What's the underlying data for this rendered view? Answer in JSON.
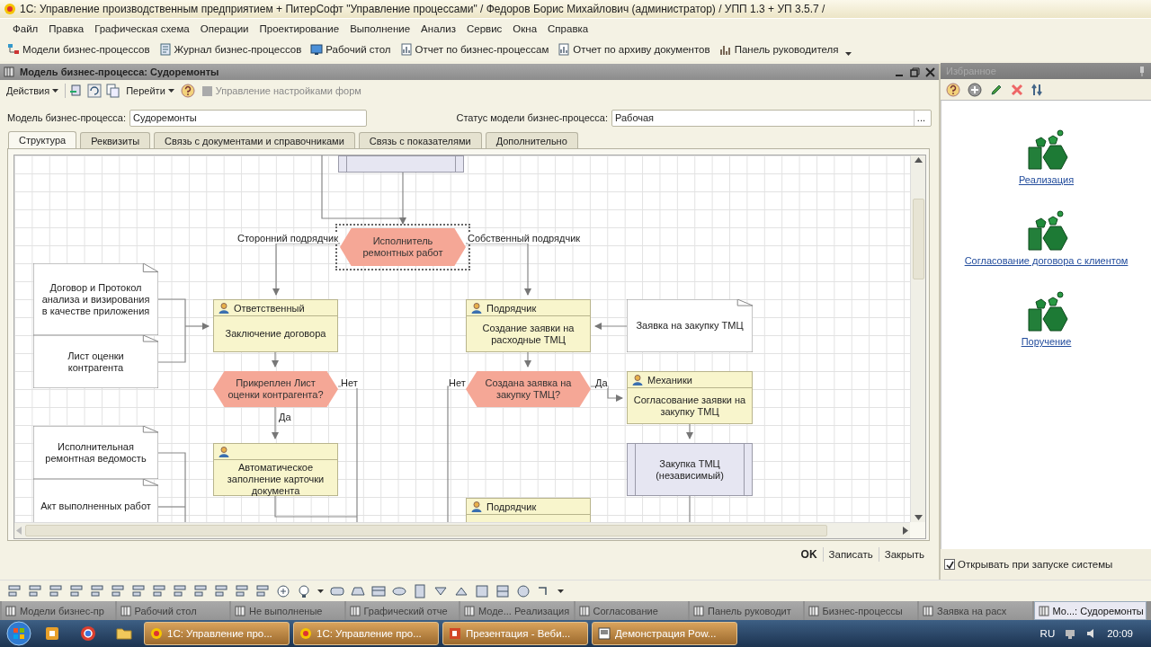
{
  "app_title": "1С: Управление производственным предприятием + ПитерСофт \"Управление процессами\" / Федоров Борис Михайлович (администратор) /  УПП 1.3 + УП 3.5.7 /",
  "menu": [
    "Файл",
    "Правка",
    "Графическая схема",
    "Операции",
    "Проектирование",
    "Выполнение",
    "Анализ",
    "Сервис",
    "Окна",
    "Справка"
  ],
  "toolbar": [
    {
      "label": "Модели бизнес-процессов"
    },
    {
      "label": "Журнал бизнес-процессов"
    },
    {
      "label": "Рабочий стол"
    },
    {
      "label": "Отчет по бизнес-процессам"
    },
    {
      "label": "Отчет по архиву документов"
    },
    {
      "label": "Панель руководителя"
    }
  ],
  "document_window": {
    "title": "Модель бизнес-процесса: Судоремонты",
    "toolbar": [
      {
        "kind": "menu",
        "label": "Действия",
        "disabled": false
      },
      {
        "kind": "menu",
        "label": "Перейти",
        "disabled": false
      },
      {
        "kind": "button",
        "label": "Управление настройками форм",
        "disabled": true
      }
    ],
    "fields": [
      {
        "label": "Модель бизнес-процесса:",
        "value": "Судоремонты"
      },
      {
        "label": "Статус модели бизнес-процесса:",
        "value": "Рабочая",
        "button": "..."
      }
    ],
    "tabs": [
      {
        "label": "Структура",
        "selected": true
      },
      {
        "label": "Реквизиты",
        "selected": false
      },
      {
        "label": "Связь с документами и справочниками",
        "selected": false
      },
      {
        "label": "Связь с показателями",
        "selected": false
      },
      {
        "label": "Дополнительно",
        "selected": false
      }
    ],
    "diagram": {
      "nodes": [
        {
          "kind": "subprocess",
          "selected": false
        },
        {
          "kind": "decision",
          "text": "Исполнитель ремонтных работ",
          "selected": true
        },
        {
          "kind": "note",
          "text": "Договор и Протокол анализа и визирования в качестве приложения",
          "selected": false
        },
        {
          "kind": "note",
          "text": "Лист оценки контрагента",
          "selected": false
        },
        {
          "kind": "task",
          "role": "Ответственный",
          "text": "Заключение договора",
          "selected": false
        },
        {
          "kind": "task",
          "role": "Подрядчик",
          "text": "Создание заявки на расходные ТМЦ",
          "selected": false
        },
        {
          "kind": "note",
          "text": "Заявка на закупку ТМЦ",
          "selected": false
        },
        {
          "kind": "decision",
          "text": "Прикреплен Лист оценки контрагента?",
          "selected": false
        },
        {
          "kind": "decision",
          "text": "Создана заявка на закупку ТМЦ?",
          "selected": false
        },
        {
          "kind": "task",
          "role": "Механики",
          "text": "Согласование заявки на закупку ТМЦ",
          "selected": false
        },
        {
          "kind": "note",
          "text": "Исполнительная ремонтная ведомость",
          "selected": false
        },
        {
          "kind": "task",
          "text": "Автоматическое заполнение карточки документа",
          "selected": false
        },
        {
          "kind": "subprocess",
          "text": "Закупка ТМЦ (независимый)",
          "selected": false
        },
        {
          "kind": "note",
          "text": "Акт выполненных работ",
          "selected": false
        },
        {
          "kind": "task",
          "role": "Подрядчик",
          "selected": false
        }
      ],
      "branch_labels": [
        "Сторонний подрядчик",
        "Собственный подрядчик",
        "Нет",
        "Да",
        "Нет",
        "Да"
      ]
    },
    "buttons": [
      {
        "kind": "default",
        "label": "OK"
      },
      {
        "kind": "normal",
        "label": "Записать"
      },
      {
        "kind": "normal",
        "label": "Закрыть"
      }
    ]
  },
  "favorites": {
    "title": "Избранное",
    "items": [
      {
        "label": "Реализация"
      },
      {
        "label": "Согласование договора с клиентом"
      },
      {
        "label": "Поручение"
      }
    ],
    "autostart": {
      "label": "Открывать при запуске системы",
      "checked": true
    }
  },
  "window_tabs": [
    {
      "label": "Модели бизнес-пр",
      "selected": false
    },
    {
      "label": "Рабочий стол",
      "selected": false
    },
    {
      "label": "Не выполненые",
      "selected": false
    },
    {
      "label": "Графический отче",
      "selected": false
    },
    {
      "label": "Моде... Реализация",
      "selected": false
    },
    {
      "label": "Согласование",
      "selected": false
    },
    {
      "label": "Панель руководит",
      "selected": false
    },
    {
      "label": "Бизнес-процессы",
      "selected": false
    },
    {
      "label": "Заявка на расх",
      "selected": false
    },
    {
      "label": "Мо...: Судоремонты",
      "selected": true
    }
  ],
  "taskbar": {
    "items": [
      {
        "label": "1С: Управление про..."
      },
      {
        "label": "1С: Управление про..."
      },
      {
        "label": "Презентация - Веби..."
      },
      {
        "label": "Демонстрация Pow..."
      }
    ],
    "language": "RU",
    "clock": "20:09"
  }
}
